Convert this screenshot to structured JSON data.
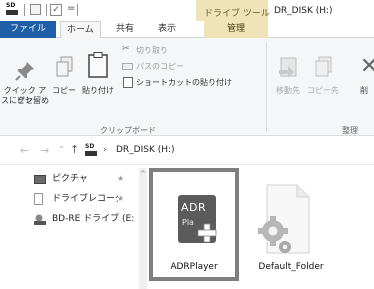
{
  "titlebar": {
    "drive_badge": "SD",
    "qat_eq": "=",
    "qat_check": "✓",
    "context_group": "ドライブ ツール",
    "window_title": "DR_DISK (H:)"
  },
  "tabs": [
    {
      "label": "ファイル"
    },
    {
      "label": "ホーム"
    },
    {
      "label": "共有"
    },
    {
      "label": "表示"
    },
    {
      "label": "管理"
    }
  ],
  "ribbon": {
    "quick_access": {
      "line1": "クイック アクセ",
      "line2": "スにピン留め"
    },
    "copy": "コピー",
    "paste": "貼り付け",
    "cut": "切り取り",
    "copy_path": "パスのコピー",
    "paste_shortcut": "ショートカットの貼り付け",
    "clipboard_group": "クリップボード",
    "move_to": "移動先",
    "copy_to": "コピー先",
    "delete_partial": "削",
    "organize_group": "整理"
  },
  "address": {
    "back": "←",
    "forward": "→",
    "recent": "⌄",
    "up": "↑",
    "drive_badge": "SD",
    "chevron": "›",
    "path": "DR_DISK (H:)"
  },
  "navpane": {
    "items": [
      {
        "label": "ピクチャ",
        "pin": "★"
      },
      {
        "label": "ドライブレコーダ-",
        "pin": "★"
      },
      {
        "label": "BD-RE ドライブ (E:"
      }
    ],
    "scroll_up": "^"
  },
  "content": {
    "items": [
      {
        "label": "ADRPlayer",
        "icon_line1": "ADR",
        "icon_line2": "Pla",
        "selected": true
      },
      {
        "label": "Default_Folder",
        "selected": false
      }
    ]
  },
  "colors": {
    "file_tab": "#1f5fa8",
    "context_tab": "#efe3b8",
    "selection_border": "#7f7f7f",
    "adr_icon": "#5b5b5b"
  }
}
